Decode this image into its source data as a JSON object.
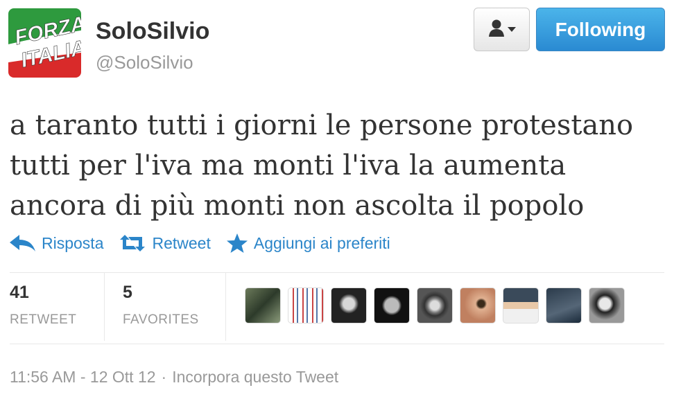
{
  "profile": {
    "display_name": "SoloSilvio",
    "handle": "@SoloSilvio",
    "avatar_logo_text_line1": "FORZA",
    "avatar_logo_text_line2": "ITALIA"
  },
  "header_actions": {
    "user_menu_icon": "user-icon",
    "follow_label": "Following"
  },
  "tweet": {
    "text_lines": [
      "a taranto tutti i giorni le persone protestano",
      "tutti per l'iva ma monti l'iva la aumenta",
      "ancora di più monti non ascolta il popolo"
    ]
  },
  "actions": {
    "reply_label": "Risposta",
    "retweet_label": "Retweet",
    "favorite_label": "Aggiungi ai preferiti"
  },
  "stats": {
    "retweets": {
      "count": "41",
      "label": "RETWEET"
    },
    "favorites": {
      "count": "5",
      "label": "FAVORITES"
    }
  },
  "footer": {
    "timestamp": "11:56 AM - 12 Ott 12",
    "separator": "·",
    "embed_label": "Incorpora questo Tweet"
  },
  "colors": {
    "link_blue": "#2b85c9",
    "follow_button": "#2a8ad2",
    "logo_green": "#2e9a3e",
    "logo_red": "#d92a2a"
  }
}
